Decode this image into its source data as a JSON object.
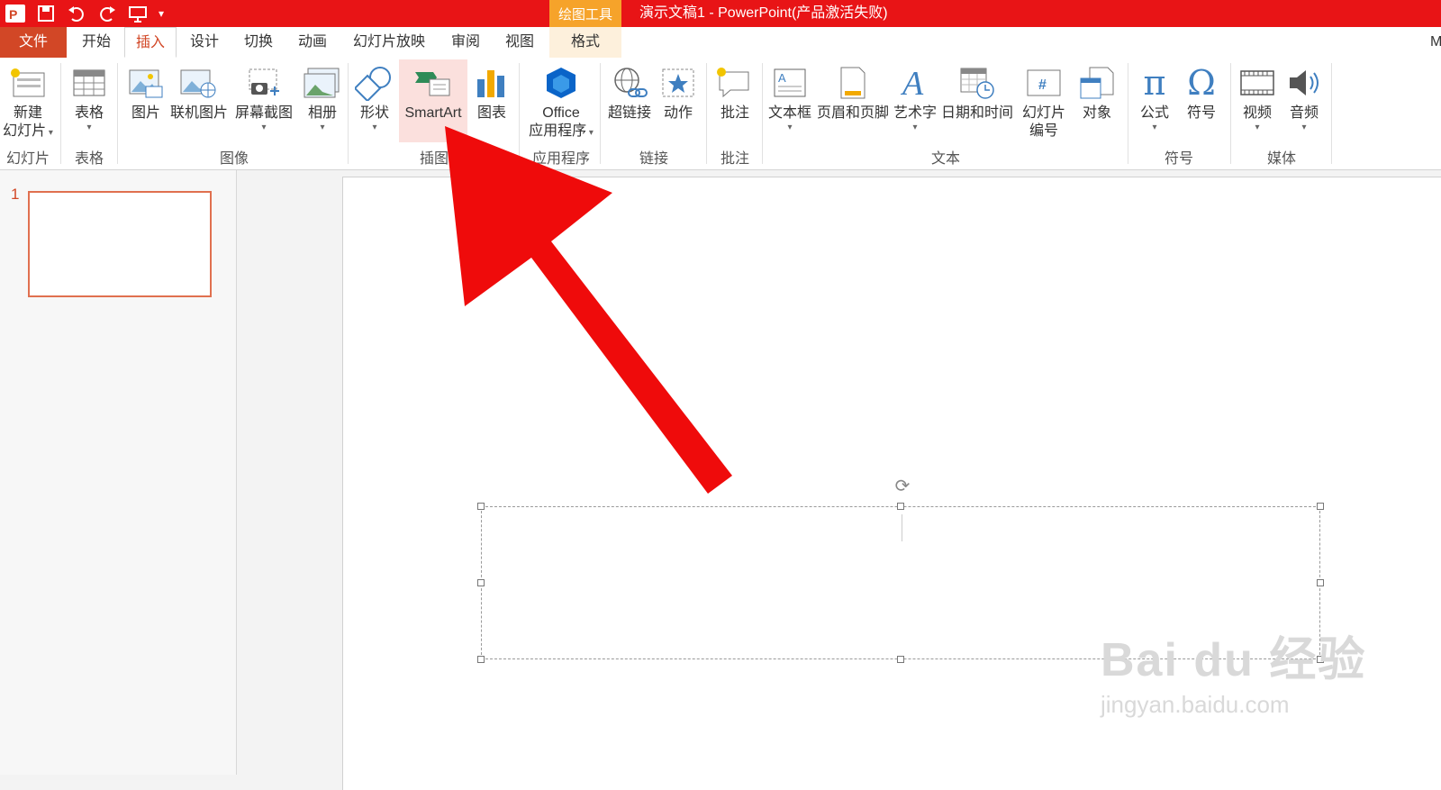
{
  "titlebar": {
    "context_group": "绘图工具",
    "title": "演示文稿1 -  PowerPoint(产品激活失败)",
    "colors": {
      "bar": "#e81416",
      "context": "#f6a32a"
    }
  },
  "qat": {
    "icons": [
      "powerpoint-logo-icon",
      "save-icon",
      "undo-icon",
      "redo-icon",
      "start-slideshow-icon",
      "customize-qat-icon"
    ]
  },
  "tabs": {
    "file": "文件",
    "home": "开始",
    "insert": "插入",
    "design": "设计",
    "transitions": "切换",
    "animations": "动画",
    "slideshow": "幻灯片放映",
    "review": "审阅",
    "view": "视图",
    "format": "格式",
    "overflow": "M"
  },
  "ribbon": {
    "new_slide": [
      "新建",
      "幻灯片"
    ],
    "table": "表格",
    "picture": "图片",
    "online_picture": "联机图片",
    "screenshot": "屏幕截图",
    "album": "相册",
    "shapes": "形状",
    "smartart": "SmartArt",
    "chart": "图表",
    "office_apps": [
      "Office",
      "应用程序"
    ],
    "hyperlink": "超链接",
    "action": "动作",
    "comment": "批注",
    "textbox": "文本框",
    "header_footer": "页眉和页脚",
    "wordart": "艺术字",
    "datetime": "日期和时间",
    "slide_number": [
      "幻灯片",
      "编号"
    ],
    "object": "对象",
    "equation": "公式",
    "symbol": "符号",
    "video": "视频",
    "audio": "音频",
    "groups": {
      "slides": "幻灯片",
      "tables": "表格",
      "images": "图像",
      "illustrations": "插图",
      "apps": "应用程序",
      "links": "链接",
      "comments": "批注",
      "text": "文本",
      "symbols": "符号",
      "media": "媒体"
    }
  },
  "thumbnails": {
    "slide_number": "1"
  },
  "watermark": {
    "brand": "Bai du 经验",
    "url": "jingyan.baidu.com"
  },
  "annotation": {
    "arrow_color": "#ef0b0b"
  }
}
